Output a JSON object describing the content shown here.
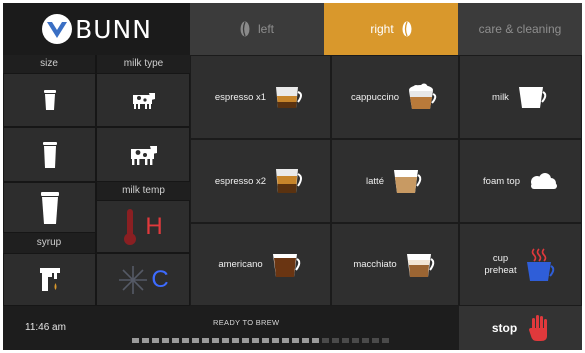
{
  "brand": {
    "name": "BUNN"
  },
  "tabs": [
    {
      "label": "left",
      "active": false
    },
    {
      "label": "right",
      "active": true
    },
    {
      "label": "care & cleaning",
      "active": false
    }
  ],
  "sidebar": {
    "size_header": "size",
    "milk_type_header": "milk type",
    "milk_temp_header": "milk temp",
    "syrup_header": "syrup",
    "temp_hot": "H",
    "temp_cold": "C"
  },
  "drinks": {
    "espresso_x1": "espresso x1",
    "cappuccino": "cappuccino",
    "milk": "milk",
    "espresso_x2": "espresso x2",
    "latte": "latté",
    "foam_top": "foam top",
    "americano": "americano",
    "macchiato": "macchiato",
    "cup_preheat": "cup\npreheat"
  },
  "status": {
    "time": "11:46 am",
    "message": "READY TO BREW",
    "progress_segments_total": 26,
    "progress_segments_filled": 19,
    "stop_label": "stop"
  },
  "colors": {
    "accent": "#d9982c",
    "hot": "#e0393c",
    "cold": "#3d6bff",
    "stop_hand": "#e0393c"
  }
}
